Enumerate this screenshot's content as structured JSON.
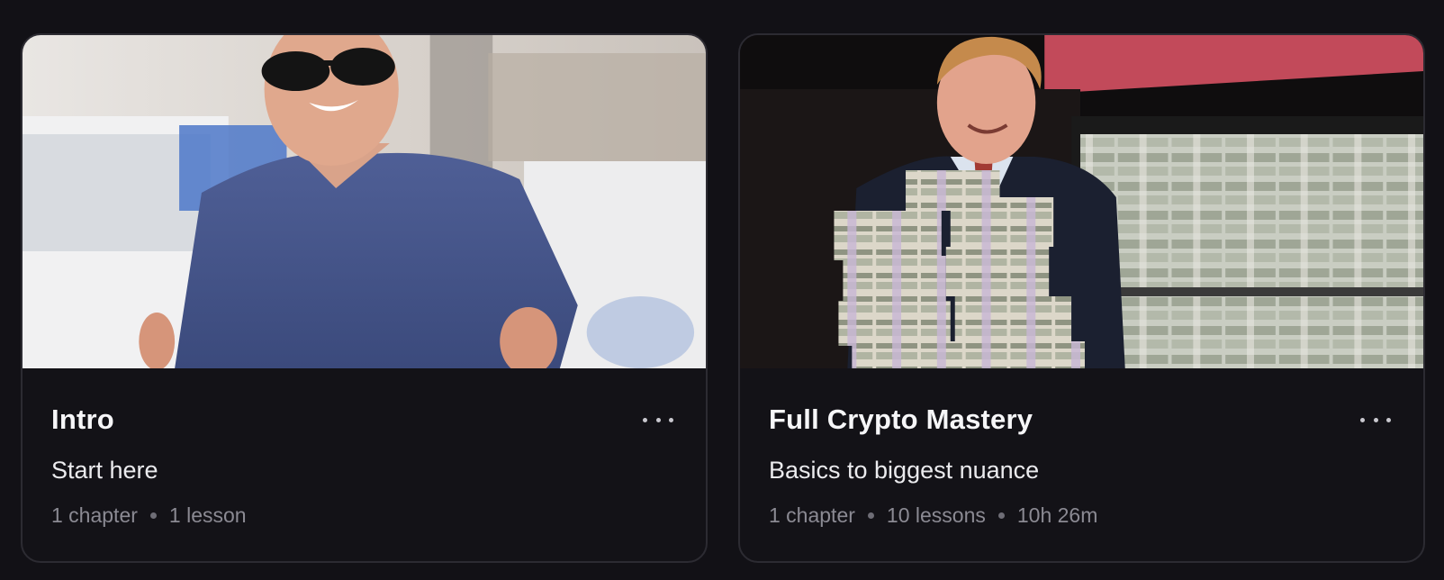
{
  "courses": [
    {
      "title": "Intro",
      "description": "Start here",
      "meta": [
        "1 chapter",
        "1 lesson"
      ],
      "thumbnail_icon": "course-thumbnail-image",
      "more_icon": "more-options-icon"
    },
    {
      "title": "Full Crypto Mastery",
      "description": "Basics to biggest nuance",
      "meta": [
        "1 chapter",
        "10 lessons",
        "10h 26m"
      ],
      "thumbnail_icon": "course-thumbnail-image",
      "more_icon": "more-options-icon"
    }
  ],
  "colors": {
    "background": "#121116",
    "card_border": "#2c2b32",
    "meta_text": "#8b8a93"
  }
}
